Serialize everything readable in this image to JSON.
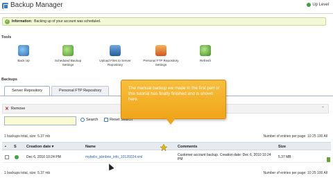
{
  "header": {
    "title": "Backup Manager",
    "up_level": "Up Level"
  },
  "info": {
    "label": "Information:",
    "message": "Backing up of your account was scheduled."
  },
  "tools": {
    "section": "Tools",
    "items": [
      {
        "label": "Back Up",
        "icon": "backup-icon"
      },
      {
        "label": "Scheduled Backup Settings",
        "icon": "scheduled-backup-icon"
      },
      {
        "label": "Upload Files to Server Repository",
        "icon": "upload-icon"
      },
      {
        "label": "Personal FTP Repository Settings",
        "icon": "ftp-settings-icon"
      },
      {
        "label": "Refresh",
        "icon": "refresh-icon"
      }
    ]
  },
  "backups": {
    "section": "Backups",
    "tabs": [
      {
        "label": "Server Repository",
        "active": true
      },
      {
        "label": "Personal FTP Repository",
        "active": false
      }
    ],
    "remove_label": "Remove",
    "search_placeholder": "",
    "search_label": "Search",
    "reset_label": "Reset Search",
    "summary_top": "1 backups total, size: 5.37 mb",
    "summary_bottom": "1 backups total, size: 5.37 mb",
    "per_page_top": "Number of entries per page: 10 25 100 All",
    "per_page_bottom": "Number of entries per page: 10 25 100 All",
    "columns": {
      "status": "S",
      "date": "Creation date ▾",
      "name": "Name",
      "comments": "Comments",
      "size": "Size"
    },
    "rows": [
      {
        "date": "Dec 6, 2010 10:24 PM",
        "name": "mybelix_jsbnbne_info_10120224.xml",
        "comments": "Customer account backup. Creation date: Dec 6, 2010 10:24 PM",
        "size": "5.37 MB"
      }
    ]
  },
  "callout": {
    "text": "The manual backup we made in the first part of this tutorial has finally finished and is shown here."
  },
  "colors": {
    "accent": "#3b79c4",
    "info_bg": "#f3f8d6",
    "callout": "#f5b027"
  }
}
